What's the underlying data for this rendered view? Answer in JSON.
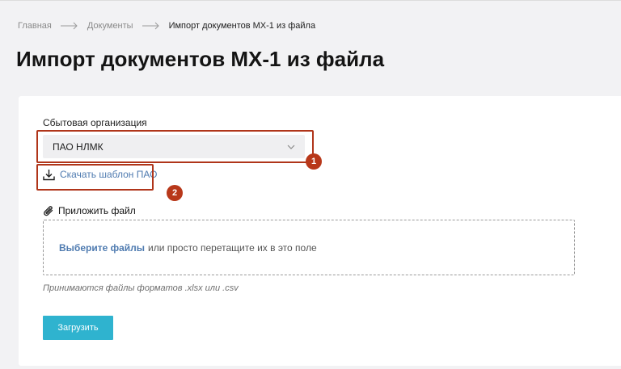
{
  "breadcrumb": {
    "items": [
      "Главная",
      "Документы",
      "Импорт документов МХ-1 из файла"
    ]
  },
  "page": {
    "title": "Импорт документов МХ-1 из файла"
  },
  "form": {
    "org_label": "Сбытовая организация",
    "org_value": "ПАО НЛМК",
    "download_label": "Скачать шаблон ПАО",
    "attach_label": "Приложить файл",
    "dropzone_pick": "Выберите файлы",
    "dropzone_rest": "или просто перетащите их в это поле",
    "hint": "Принимаются файлы форматов .xlsx или .csv",
    "submit_label": "Загрузить"
  },
  "annotations": {
    "badge_1": "1",
    "badge_2": "2",
    "color": "#b8381a"
  },
  "colors": {
    "accent": "#2fb3cf",
    "link": "#4f7bb0",
    "background": "#f2f2f4"
  },
  "icons": [
    "arrow-right-icon",
    "chevron-down-icon",
    "download-icon",
    "paperclip-icon"
  ]
}
